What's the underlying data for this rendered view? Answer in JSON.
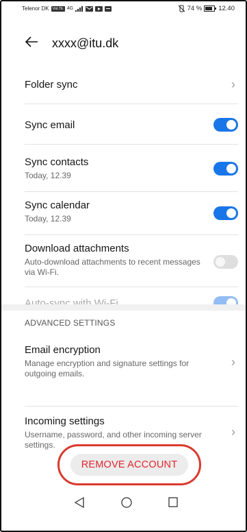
{
  "status_bar": {
    "carrier": "Telenor DK",
    "chip": "VoLTE",
    "network": "4G",
    "battery_percent": "74 %",
    "time": "12.40"
  },
  "header": {
    "back_icon": "arrow-left-icon",
    "title": "xxxx@itu.dk"
  },
  "settings": {
    "folder_sync": {
      "label": "Folder sync"
    },
    "sync_email": {
      "label": "Sync email",
      "enabled": true
    },
    "sync_contacts": {
      "label": "Sync contacts",
      "sub": "Today, 12.39",
      "enabled": true
    },
    "sync_calendar": {
      "label": "Sync calendar",
      "sub": "Today, 12.39",
      "enabled": true
    },
    "download_attachments": {
      "label": "Download attachments",
      "sub": "Auto-download attachments to recent messages via Wi-Fi.",
      "enabled": false
    },
    "auto_sync_wifi": {
      "label": "Auto-sync with Wi-Fi",
      "enabled": true,
      "disabled": true
    }
  },
  "advanced": {
    "heading": "ADVANCED SETTINGS",
    "email_encryption": {
      "label": "Email encryption",
      "sub": "Manage encryption and signature settings for outgoing emails."
    },
    "incoming_settings": {
      "label": "Incoming settings",
      "sub": "Username, password, and other incoming server settings."
    }
  },
  "remove_account": {
    "label": "REMOVE ACCOUNT",
    "highlight_color": "#d93a2e"
  },
  "colors": {
    "accent": "#1976e8",
    "danger": "#e0252e"
  }
}
